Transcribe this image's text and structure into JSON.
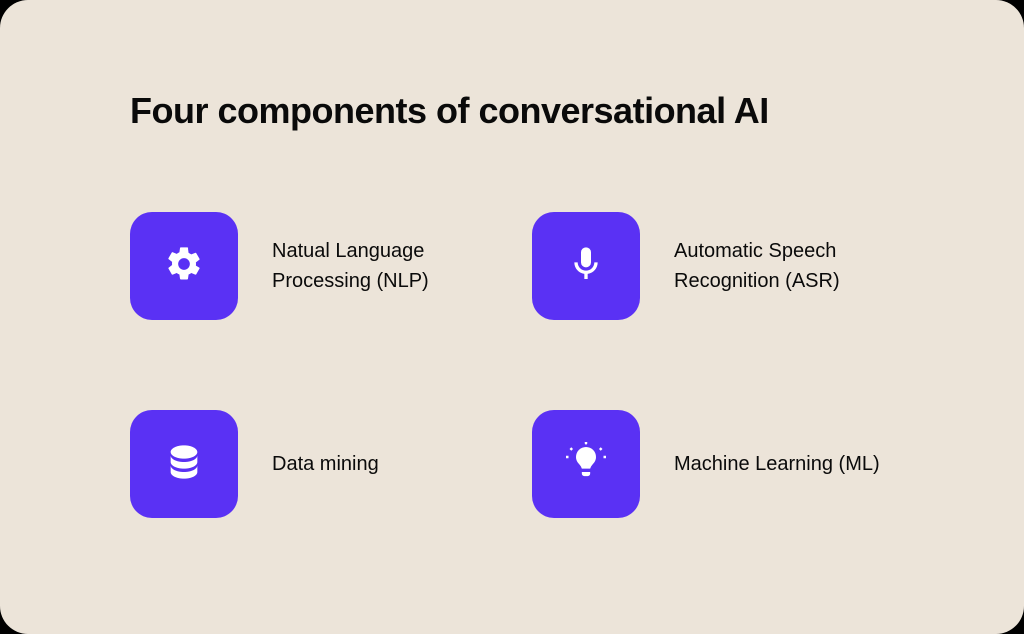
{
  "title": "Four components of conversational AI",
  "items": [
    {
      "label": "Natual Language Processing (NLP)",
      "icon": "gear-icon"
    },
    {
      "label": "Automatic Speech Recognition (ASR)",
      "icon": "microphone-icon"
    },
    {
      "label": "Data mining",
      "icon": "database-icon"
    },
    {
      "label": "Machine Learning (ML)",
      "icon": "lightbulb-icon"
    }
  ],
  "colors": {
    "tile": "#5a31f4",
    "background": "#ece4d9"
  }
}
